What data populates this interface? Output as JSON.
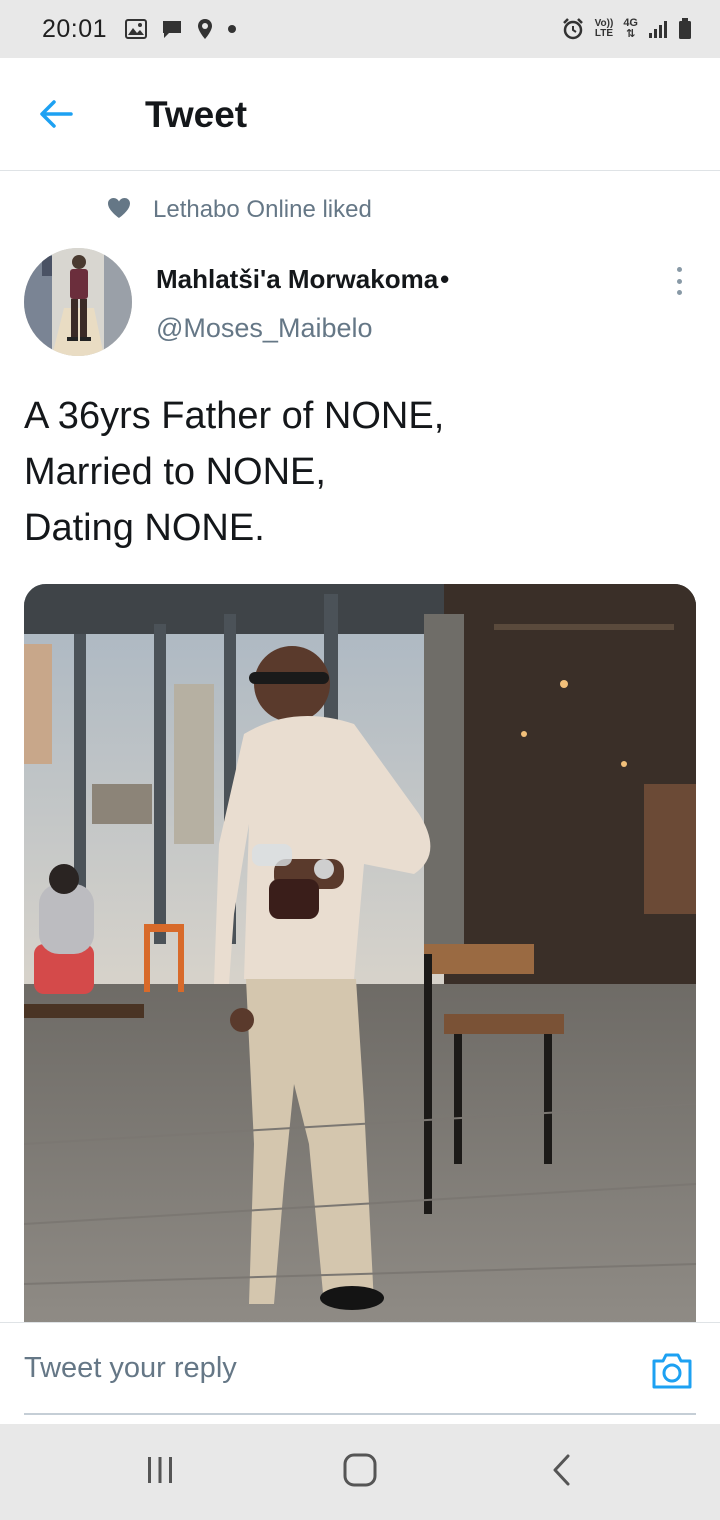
{
  "status_bar": {
    "time": "20:01",
    "volte_line1": "Vo))",
    "volte_line2": "LTE",
    "network": "4G",
    "icons": [
      "gallery-icon",
      "message-icon",
      "location-icon",
      "dot-icon",
      "alarm-icon",
      "volte-icon",
      "network-icon",
      "signal-icon",
      "battery-icon"
    ]
  },
  "header": {
    "title": "Tweet",
    "back_icon": "back-arrow-icon"
  },
  "tweet": {
    "social_context": "Lethabo Online liked",
    "author_name": "Mahlatši'a Morwakoma",
    "author_suffix": "•",
    "author_handle": "@Moses_Maibelo",
    "text_lines": [
      "A 36yrs Father of NONE,",
      "Married to NONE,",
      "Dating NONE."
    ]
  },
  "reply": {
    "placeholder": "Tweet your reply",
    "camera_icon": "camera-icon"
  },
  "nav_bar": {
    "icons": [
      "recent-apps-icon",
      "home-icon",
      "back-icon"
    ]
  },
  "colors": {
    "accent": "#1da1f2",
    "secondary_text": "#657786",
    "primary_text": "#14171a",
    "system_bar": "#e8e8e8"
  }
}
